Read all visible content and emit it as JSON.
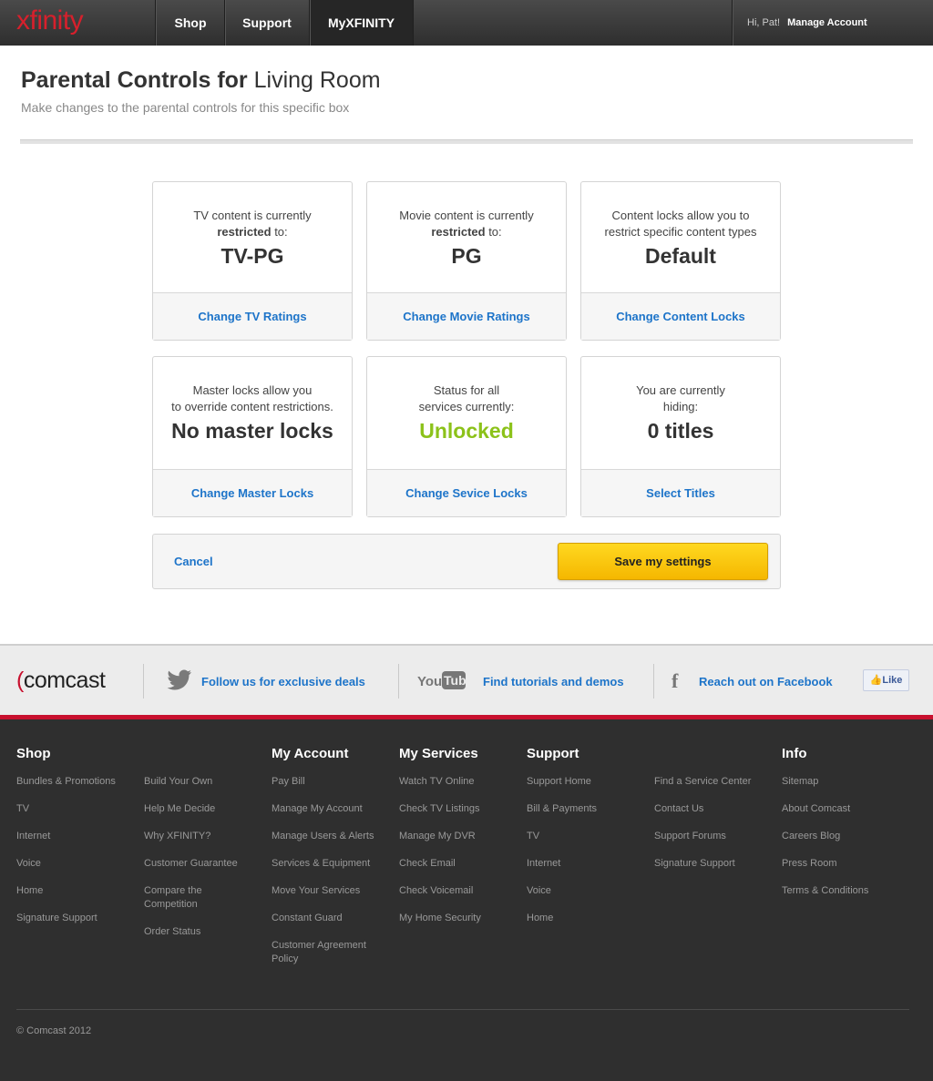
{
  "nav": {
    "logo": "xfinity",
    "items": [
      {
        "label": "Shop"
      },
      {
        "label": "Support"
      },
      {
        "label": "MyXFINITY"
      }
    ],
    "greeting": "Hi, Pat!",
    "manage_account": "Manage Account"
  },
  "header": {
    "title_bold": "Parental Controls for",
    "title_light": "Living Room",
    "subtitle": "Make changes to the parental controls for this specific box"
  },
  "cards": [
    {
      "line1": "TV content is currently",
      "line2_bold": "restricted",
      "line2_rest": " to:",
      "value": "TV-PG",
      "action": "Change TV Ratings"
    },
    {
      "line1": "Movie content is currently",
      "line2_bold": "restricted",
      "line2_rest": " to:",
      "value": "PG",
      "action": "Change Movie Ratings"
    },
    {
      "line1": "Content locks allow you to",
      "line2": "restrict specific content types",
      "value": "Default",
      "action": "Change Content Locks"
    },
    {
      "line1": "Master locks allow you",
      "line2": "to override content restrictions.",
      "value": "No master locks",
      "action": "Change Master Locks"
    },
    {
      "line1": "Status for all",
      "line2": "services currently:",
      "value": "Unlocked",
      "action": "Change Sevice Locks"
    },
    {
      "line1": "You are currently",
      "line2": "hiding:",
      "value": "0 titles",
      "action": "Select Titles"
    }
  ],
  "actions": {
    "cancel": "Cancel",
    "save": "Save my settings"
  },
  "social": {
    "brand": "comcast",
    "twitter": "Follow us for exclusive deals",
    "youtube_icon_text": "YouTube",
    "youtube": "Find tutorials and demos",
    "facebook": "Reach out on Facebook",
    "like": "Like"
  },
  "footer": {
    "shop": {
      "heading": "Shop",
      "col1": [
        "Bundles & Promotions",
        "TV",
        "Internet",
        "Voice",
        "Home",
        "Signature Support"
      ],
      "col2": [
        "Build Your Own",
        "Help Me Decide",
        "Why XFINITY?",
        "Customer Guarantee",
        "Compare the Competition",
        "Order Status"
      ]
    },
    "account": {
      "heading": "My Account",
      "col1": [
        "Pay Bill",
        "Manage My Account",
        "Manage Users & Alerts",
        "Services & Equipment",
        "Move Your Services",
        "Constant Guard",
        "Customer Agreement Policy"
      ]
    },
    "services": {
      "heading": "My Services",
      "col1": [
        "Watch TV Online",
        "Check TV Listings",
        "Manage My DVR",
        "Check Email",
        "Check Voicemail",
        "My Home Security"
      ]
    },
    "support": {
      "heading": "Support",
      "col1": [
        "Support Home",
        "Bill & Payments",
        "TV",
        "Internet",
        "Voice",
        "Home"
      ],
      "col2": [
        "Find a Service Center",
        "Contact Us",
        "Support Forums",
        "Signature Support"
      ]
    },
    "info": {
      "heading": "Info",
      "col1": [
        "Sitemap",
        "About Comcast",
        "Careers Blog",
        "Press Room",
        "Terms & Conditions"
      ]
    },
    "copyright": "© Comcast 2012"
  },
  "colors": {
    "brand_red": "#d6202c",
    "link_blue": "#1d74c9",
    "unlocked_green": "#8cc21a",
    "save_yellow": "#ffd820"
  }
}
